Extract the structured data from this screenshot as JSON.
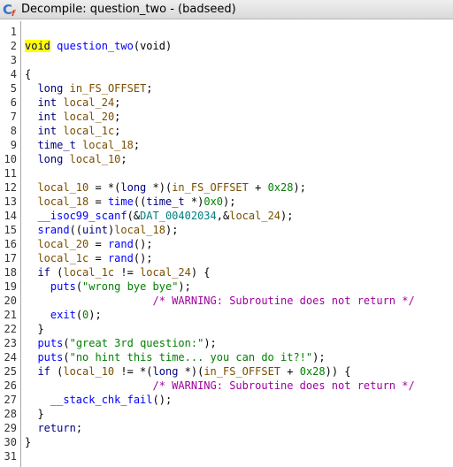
{
  "window": {
    "title": "Decompile: question_two -  (badseed)",
    "icon": "decompile-c-icon",
    "icon_glyph": "C",
    "icon_subglyph": "f"
  },
  "colors": {
    "keyword": "#000080",
    "function": "#0000ff",
    "variable": "#7a4e00",
    "string": "#008000",
    "comment": "#a000a0",
    "global": "#008080",
    "highlight": "#ffff00"
  },
  "code": [
    {
      "n": "1",
      "t": []
    },
    {
      "n": "2",
      "t": [
        [
          "kw hl",
          "void"
        ],
        [
          "",
          "",
          " "
        ],
        [
          "fn",
          "question_two"
        ],
        [
          "",
          "(void)"
        ]
      ]
    },
    {
      "n": "3",
      "t": []
    },
    {
      "n": "4",
      "t": [
        [
          "",
          "{"
        ]
      ]
    },
    {
      "n": "5",
      "t": [
        [
          "",
          "  "
        ],
        [
          "ty",
          "long"
        ],
        [
          "",
          " "
        ],
        [
          "var",
          "in_FS_OFFSET"
        ],
        [
          "",
          ";"
        ]
      ]
    },
    {
      "n": "6",
      "t": [
        [
          "",
          "  "
        ],
        [
          "ty",
          "int"
        ],
        [
          "",
          " "
        ],
        [
          "var",
          "local_24"
        ],
        [
          "",
          ";"
        ]
      ]
    },
    {
      "n": "7",
      "t": [
        [
          "",
          "  "
        ],
        [
          "ty",
          "int"
        ],
        [
          "",
          " "
        ],
        [
          "var",
          "local_20"
        ],
        [
          "",
          ";"
        ]
      ]
    },
    {
      "n": "8",
      "t": [
        [
          "",
          "  "
        ],
        [
          "ty",
          "int"
        ],
        [
          "",
          " "
        ],
        [
          "var",
          "local_1c"
        ],
        [
          "",
          ";"
        ]
      ]
    },
    {
      "n": "9",
      "t": [
        [
          "",
          "  "
        ],
        [
          "ty",
          "time_t"
        ],
        [
          "",
          " "
        ],
        [
          "var",
          "local_18"
        ],
        [
          "",
          ";"
        ]
      ]
    },
    {
      "n": "10",
      "t": [
        [
          "",
          "  "
        ],
        [
          "ty",
          "long"
        ],
        [
          "",
          " "
        ],
        [
          "var",
          "local_10"
        ],
        [
          "",
          ";"
        ]
      ]
    },
    {
      "n": "11",
      "t": []
    },
    {
      "n": "12",
      "t": [
        [
          "",
          "  "
        ],
        [
          "var",
          "local_10"
        ],
        [
          "",
          " = *("
        ],
        [
          "ty",
          "long"
        ],
        [
          "",
          " *)("
        ],
        [
          "var",
          "in_FS_OFFSET"
        ],
        [
          "",
          " + "
        ],
        [
          "num",
          "0x28"
        ],
        [
          "",
          ");"
        ]
      ]
    },
    {
      "n": "13",
      "t": [
        [
          "",
          "  "
        ],
        [
          "var",
          "local_18"
        ],
        [
          "",
          " = "
        ],
        [
          "fn",
          "time"
        ],
        [
          "",
          "(("
        ],
        [
          "ty",
          "time_t"
        ],
        [
          "",
          " *)"
        ],
        [
          "num",
          "0x0"
        ],
        [
          "",
          ");"
        ]
      ]
    },
    {
      "n": "14",
      "t": [
        [
          "",
          "  "
        ],
        [
          "fn",
          "__isoc99_scanf"
        ],
        [
          "",
          "(&"
        ],
        [
          "glob",
          "DAT_00402034"
        ],
        [
          "",
          ",&"
        ],
        [
          "var",
          "local_24"
        ],
        [
          "",
          ");"
        ]
      ]
    },
    {
      "n": "15",
      "t": [
        [
          "",
          "  "
        ],
        [
          "fn",
          "srand"
        ],
        [
          "",
          "(("
        ],
        [
          "ty",
          "uint"
        ],
        [
          "",
          ")"
        ],
        [
          "var",
          "local_18"
        ],
        [
          "",
          ");"
        ]
      ]
    },
    {
      "n": "16",
      "t": [
        [
          "",
          "  "
        ],
        [
          "var",
          "local_20"
        ],
        [
          "",
          " = "
        ],
        [
          "fn",
          "rand"
        ],
        [
          "",
          "();"
        ]
      ]
    },
    {
      "n": "17",
      "t": [
        [
          "",
          "  "
        ],
        [
          "var",
          "local_1c"
        ],
        [
          "",
          " = "
        ],
        [
          "fn",
          "rand"
        ],
        [
          "",
          "();"
        ]
      ]
    },
    {
      "n": "18",
      "t": [
        [
          "",
          "  "
        ],
        [
          "kw",
          "if"
        ],
        [
          "",
          " ("
        ],
        [
          "var",
          "local_1c"
        ],
        [
          "",
          " != "
        ],
        [
          "var",
          "local_24"
        ],
        [
          "",
          ") {"
        ]
      ]
    },
    {
      "n": "19",
      "t": [
        [
          "",
          "    "
        ],
        [
          "fn",
          "puts"
        ],
        [
          "",
          "("
        ],
        [
          "str",
          "\"wrong bye bye\""
        ],
        [
          "",
          ");"
        ]
      ]
    },
    {
      "n": "20",
      "t": [
        [
          "",
          "                    "
        ],
        [
          "cmt",
          "/* WARNING: Subroutine does not return */"
        ]
      ]
    },
    {
      "n": "21",
      "t": [
        [
          "",
          "    "
        ],
        [
          "fn",
          "exit"
        ],
        [
          "",
          "("
        ],
        [
          "num",
          "0"
        ],
        [
          "",
          ");"
        ]
      ]
    },
    {
      "n": "22",
      "t": [
        [
          "",
          "  }"
        ]
      ]
    },
    {
      "n": "23",
      "t": [
        [
          "",
          "  "
        ],
        [
          "fn",
          "puts"
        ],
        [
          "",
          "("
        ],
        [
          "str",
          "\"great 3rd question:\""
        ],
        [
          "",
          ");"
        ]
      ]
    },
    {
      "n": "24",
      "t": [
        [
          "",
          "  "
        ],
        [
          "fn",
          "puts"
        ],
        [
          "",
          "("
        ],
        [
          "str",
          "\"no hint this time... you can do it?!\""
        ],
        [
          "",
          ");"
        ]
      ]
    },
    {
      "n": "25",
      "t": [
        [
          "",
          "  "
        ],
        [
          "kw",
          "if"
        ],
        [
          "",
          " ("
        ],
        [
          "var",
          "local_10"
        ],
        [
          "",
          " != *("
        ],
        [
          "ty",
          "long"
        ],
        [
          "",
          " *)("
        ],
        [
          "var",
          "in_FS_OFFSET"
        ],
        [
          "",
          " + "
        ],
        [
          "num",
          "0x28"
        ],
        [
          "",
          ")) {"
        ]
      ]
    },
    {
      "n": "26",
      "t": [
        [
          "",
          "                    "
        ],
        [
          "cmt",
          "/* WARNING: Subroutine does not return */"
        ]
      ]
    },
    {
      "n": "27",
      "t": [
        [
          "",
          "    "
        ],
        [
          "fn",
          "__stack_chk_fail"
        ],
        [
          "",
          "();"
        ]
      ]
    },
    {
      "n": "28",
      "t": [
        [
          "",
          "  }"
        ]
      ]
    },
    {
      "n": "29",
      "t": [
        [
          "",
          "  "
        ],
        [
          "kw",
          "return"
        ],
        [
          "",
          ";"
        ]
      ]
    },
    {
      "n": "30",
      "t": [
        [
          "",
          "}"
        ]
      ]
    },
    {
      "n": "31",
      "t": []
    }
  ]
}
